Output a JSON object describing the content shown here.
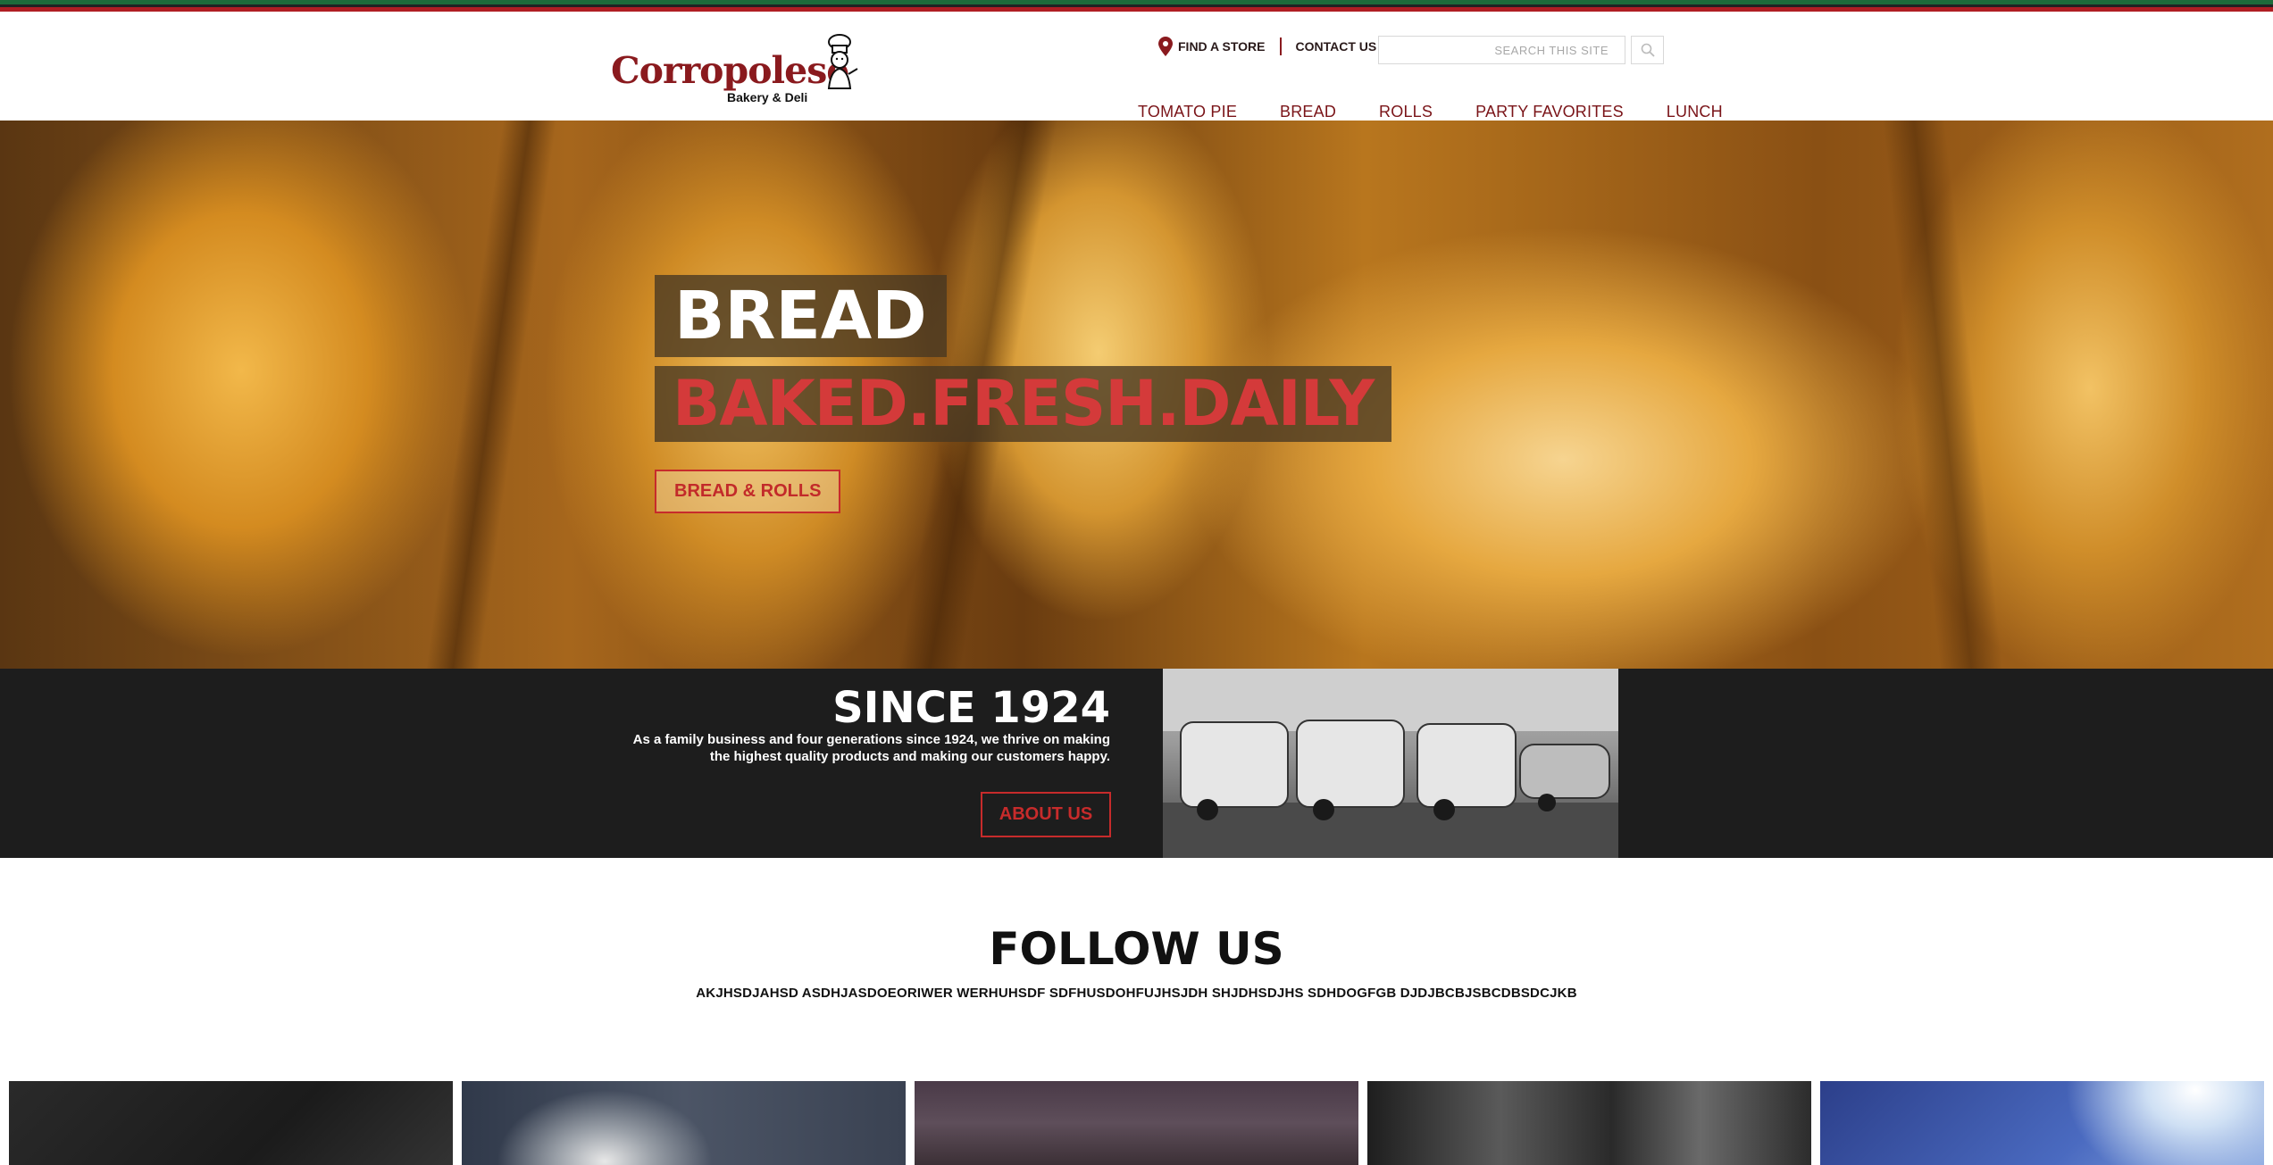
{
  "header": {
    "logo": {
      "name": "Corropolese",
      "subtitle": "Bakery & Deli"
    },
    "utility": {
      "find_store": "FIND A STORE",
      "contact": "CONTACT US"
    },
    "search": {
      "placeholder": "SEARCH THIS SITE"
    },
    "nav": [
      {
        "label": "TOMATO PIE"
      },
      {
        "label": "BREAD"
      },
      {
        "label": "ROLLS"
      },
      {
        "label": "PARTY FAVORITES"
      },
      {
        "label": "LUNCH"
      }
    ]
  },
  "hero": {
    "title": "BREAD",
    "tagline": "BAKED.FRESH.DAILY",
    "button": "BREAD & ROLLS"
  },
  "since": {
    "title": "SINCE 1924",
    "text": "As a family business and four generations since 1924, we thrive on making the highest quality products and making our customers happy.",
    "button": "ABOUT US"
  },
  "follow": {
    "title": "FOLLOW US",
    "text": "AKJHSDJAHSD ASDHJASDOEORIWER WERHUHSDF SDFHUSDOHFUJHSJDH SHJDHSDJHS SDHDOGFGB DJDJBCBJSBCDBSDCJKB"
  },
  "colors": {
    "brand": "#8a1a1e",
    "accent_red": "#c72b2b",
    "stripe_green": "#1e6b3a",
    "stripe_red": "#b01e23",
    "dark_band": "#1d1d1d"
  },
  "icons": {
    "find_store": "map-pin-icon",
    "search": "search-icon",
    "logo": "chef-icon"
  }
}
